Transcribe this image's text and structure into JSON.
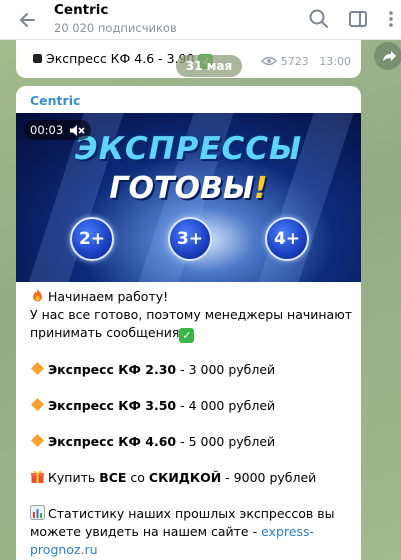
{
  "header": {
    "title": "Centric",
    "subscribers": "20 020 подписчиков"
  },
  "prev_message": {
    "text": "Экспресс КФ 4.6 - 3.90",
    "views": "5723",
    "time": "13:00"
  },
  "date_separator": "31 мая",
  "post": {
    "channel": "Centric",
    "video_time": "00:03",
    "banner_line1": "ЭКСПРЕССЫ",
    "banner_line2": "ГОТОВЫ",
    "banner_excl": "!",
    "badges": [
      "2+",
      "3+",
      "4+"
    ],
    "intro_line1": "Начинаем работу!",
    "intro_line2": "У нас все готово, поэтому менеджеры начинают",
    "intro_line3": "принимать сообщения",
    "items": [
      {
        "name": "Экспресс КФ 2.30",
        "price": " - 3 000 рублей"
      },
      {
        "name": "Экспресс КФ 3.50",
        "price": " - 4 000 рублей"
      },
      {
        "name": "Экспресс КФ 4.60",
        "price": " - 5 000 рублей"
      }
    ],
    "bundle_pre": "Купить ",
    "bundle_all": "ВСЕ",
    "bundle_mid": " со ",
    "bundle_discount": "СКИДКОЙ",
    "bundle_price": " - 9000 рублей",
    "stats_line1": "Статистику наших прошлых экспрессов вы",
    "stats_line2": "можете увидеть на нашем сайте - ",
    "stats_link1": "express-",
    "stats_link2": "prognoz.ru"
  },
  "colors": {
    "accent": "#3b8fc6",
    "link": "#2f7fbf",
    "chat_bg": "#9fb58f"
  }
}
